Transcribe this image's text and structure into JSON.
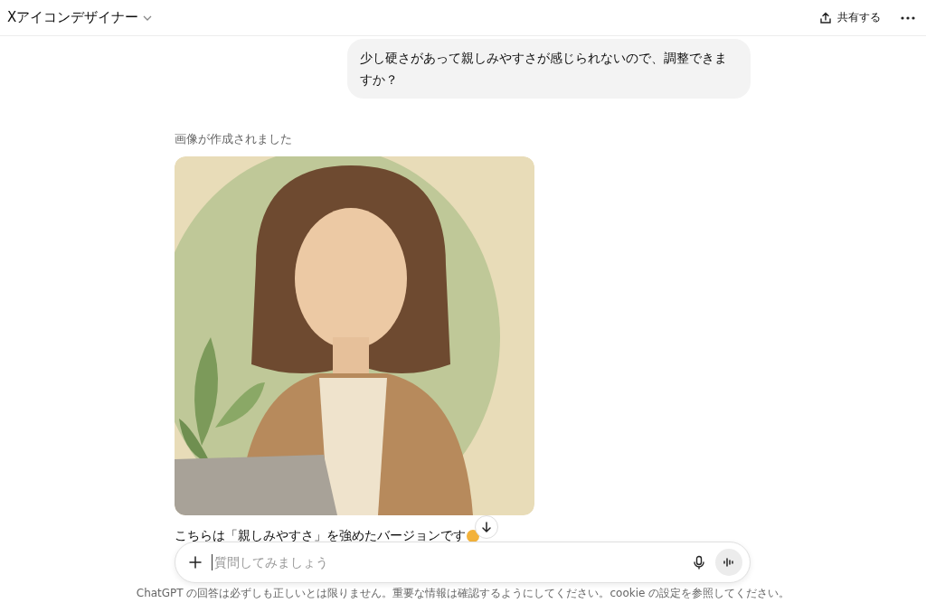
{
  "header": {
    "title": "Xアイコンデザイナー",
    "share_label": "共有する"
  },
  "messages": [
    {
      "kind": "user",
      "text": "少し硬さがあって親しみやすさが感じられないので、調整できますか？"
    },
    {
      "status": "画像が作成されました"
    },
    {
      "kind": "assistant",
      "text": "こちらは「親しみやすさ」を強めたバージョンです"
    }
  ],
  "composer": {
    "placeholder": "質問してみましょう"
  },
  "footer": "ChatGPT の回答は必ずしも正しいとは限りません。重要な情報は確認するようにしてください。cookie の設定を参照してください。"
}
